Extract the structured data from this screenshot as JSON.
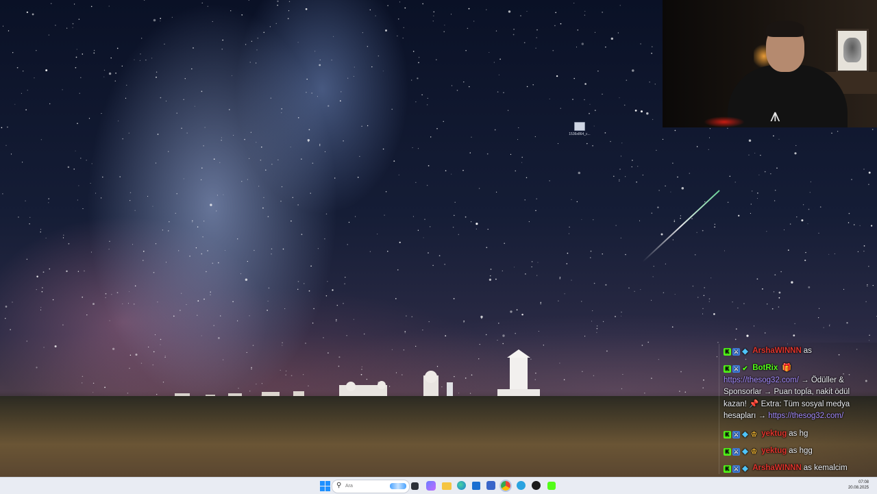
{
  "desktop": {
    "icon_label": "1536x864_c..."
  },
  "chat": {
    "messages": [
      {
        "user": "ArshaWINNN",
        "user_color": "#e0342c",
        "text": "as"
      },
      {
        "user": "BotRix",
        "user_color": "#53fc18",
        "link1": "https://thesog32.com/",
        "text1": " → Ödüller & Sponsorlar → Puan topla, nakit ödül kazan! ",
        "pin": "📌",
        "text2": " Extra: Tüm sosyal medya hesapları → ",
        "link2": "https://thesog32.com/"
      },
      {
        "user": "yektug",
        "user_color": "#e0342c",
        "text": "as hg"
      },
      {
        "user": "yektug",
        "user_color": "#e0342c",
        "text": "as hgg"
      },
      {
        "user": "ArshaWINNN",
        "user_color": "#e0342c",
        "text": "as kemalcim"
      }
    ]
  },
  "taskbar": {
    "search_placeholder": "Ara",
    "time": "07:08",
    "date": "20.08.2025",
    "apps": [
      "task-view-icon",
      "widgets-icon",
      "file-explorer-icon",
      "edge-icon",
      "store-icon",
      "obs-icon",
      "chrome-icon",
      "telegram-icon",
      "spotify-like-icon",
      "kick-icon"
    ]
  }
}
